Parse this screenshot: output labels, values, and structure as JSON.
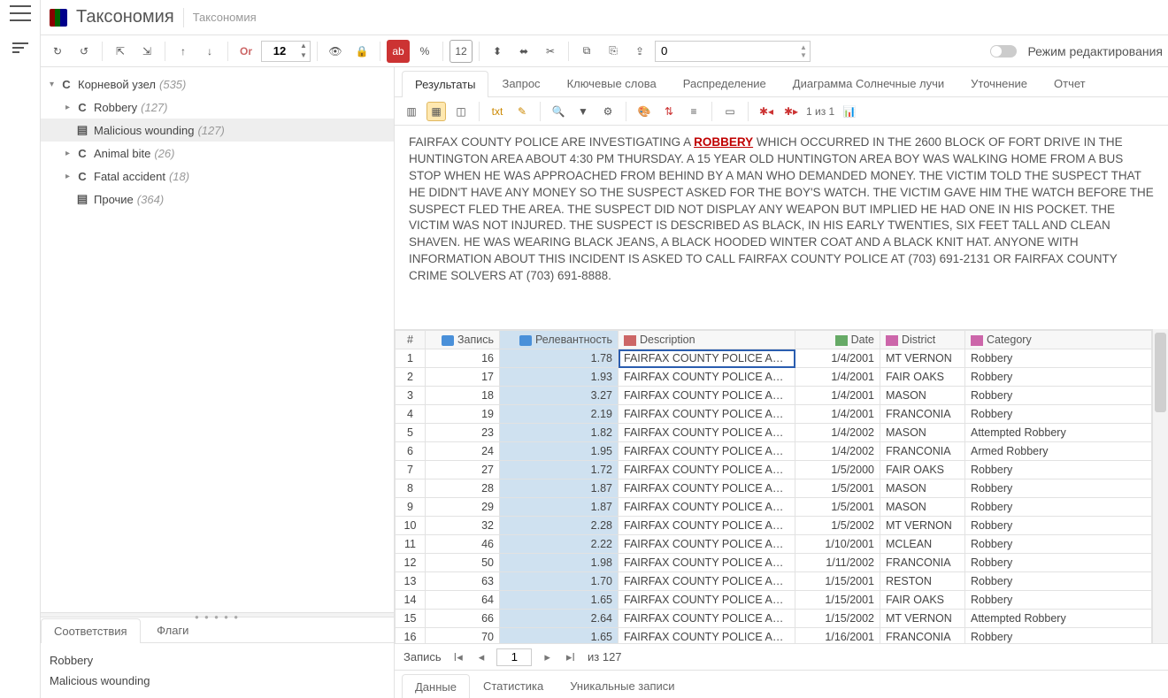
{
  "header": {
    "title": "Таксономия",
    "subtitle": "Таксономия"
  },
  "toolbar": {
    "font_size": "12",
    "offset": "0",
    "edit_mode_label": "Режим редактирования"
  },
  "tree": {
    "root": {
      "type": "C",
      "label": "Корневой узел",
      "count": "(535)"
    },
    "items": [
      {
        "type": "C",
        "label": "Robbery",
        "count": "(127)"
      },
      {
        "type": "▤",
        "label": "Malicious wounding",
        "count": "(127)",
        "selected": true
      },
      {
        "type": "C",
        "label": "Animal bite",
        "count": "(26)"
      },
      {
        "type": "C",
        "label": "Fatal accident",
        "count": "(18)"
      },
      {
        "type": "▤",
        "label": "Прочие",
        "count": "(364)"
      }
    ]
  },
  "left_bottom": {
    "tabs": {
      "match": "Соответствия",
      "flags": "Флаги"
    },
    "items": [
      "Robbery",
      "Malicious wounding"
    ]
  },
  "right_tabs": {
    "results": "Результаты",
    "query": "Запрос",
    "keywords": "Ключевые слова",
    "dist": "Распределение",
    "sunburst": "Диаграмма Солнечные лучи",
    "refine": "Уточнение",
    "report": "Отчет"
  },
  "right_toolbar": {
    "counter": "1 из 1"
  },
  "passage": {
    "pre": "FAIRFAX COUNTY POLICE ARE INVESTIGATING A ",
    "hl": "ROBBERY",
    "post": " WHICH OCCURRED IN THE 2600 BLOCK OF FORT DRIVE IN THE HUNTINGTON AREA ABOUT 4:30 PM THURSDAY. A 15 YEAR OLD HUNTINGTON AREA BOY WAS WALKING HOME FROM A BUS STOP WHEN HE WAS APPROACHED FROM BEHIND BY A MAN WHO DEMANDED MONEY. THE VICTIM TOLD THE SUSPECT THAT HE DIDN'T HAVE ANY MONEY SO THE SUSPECT ASKED FOR THE BOY'S WATCH. THE VICTIM GAVE HIM THE WATCH BEFORE THE SUSPECT FLED THE AREA. THE SUSPECT DID NOT DISPLAY ANY WEAPON BUT IMPLIED HE HAD ONE IN HIS POCKET. THE VICTIM WAS NOT INJURED. THE SUSPECT IS DESCRIBED AS BLACK, IN HIS EARLY TWENTIES, SIX FEET TALL AND CLEAN SHAVEN. HE WAS WEARING BLACK JEANS, A BLACK HOODED WINTER COAT AND A BLACK KNIT HAT. ANYONE WITH INFORMATION ABOUT THIS INCIDENT IS ASKED TO CALL FAIRFAX COUNTY POLICE AT (703) 691-2131 OR FAIRFAX COUNTY CRIME SOLVERS AT (703) 691-8888."
  },
  "grid": {
    "headers": {
      "idx": "#",
      "rec": "Запись",
      "rel": "Релевантность",
      "desc": "Description",
      "date": "Date",
      "dist": "District",
      "cat": "Category"
    },
    "rows": [
      {
        "i": "1",
        "rec": "16",
        "rel": "1.78",
        "desc": "FAIRFAX COUNTY POLICE ARE INVE",
        "date": "1/4/2001",
        "dist": "MT VERNON",
        "cat": "Robbery"
      },
      {
        "i": "2",
        "rec": "17",
        "rel": "1.93",
        "desc": "FAIRFAX COUNTY POLICE ARE INVE",
        "date": "1/4/2001",
        "dist": "FAIR OAKS",
        "cat": "Robbery"
      },
      {
        "i": "3",
        "rec": "18",
        "rel": "3.27",
        "desc": "FAIRFAX COUNTY POLICE ARE INVE",
        "date": "1/4/2001",
        "dist": "MASON",
        "cat": "Robbery"
      },
      {
        "i": "4",
        "rec": "19",
        "rel": "2.19",
        "desc": "FAIRFAX COUNTY POLICE ARE INVE",
        "date": "1/4/2001",
        "dist": "FRANCONIA",
        "cat": "Robbery"
      },
      {
        "i": "5",
        "rec": "23",
        "rel": "1.82",
        "desc": "FAIRFAX COUNTY POLICE ARE INVE",
        "date": "1/4/2002",
        "dist": "MASON",
        "cat": "Attempted Robbery"
      },
      {
        "i": "6",
        "rec": "24",
        "rel": "1.95",
        "desc": "FAIRFAX COUNTY POLICE ARE INVE",
        "date": "1/4/2002",
        "dist": "FRANCONIA",
        "cat": "Armed Robbery"
      },
      {
        "i": "7",
        "rec": "27",
        "rel": "1.72",
        "desc": "FAIRFAX COUNTY POLICE ARE INVE",
        "date": "1/5/2000",
        "dist": "FAIR OAKS",
        "cat": "Robbery"
      },
      {
        "i": "8",
        "rec": "28",
        "rel": "1.87",
        "desc": "FAIRFAX COUNTY POLICE ARE INVE",
        "date": "1/5/2001",
        "dist": "MASON",
        "cat": "Robbery"
      },
      {
        "i": "9",
        "rec": "29",
        "rel": "1.87",
        "desc": "FAIRFAX COUNTY POLICE ARE INVE",
        "date": "1/5/2001",
        "dist": "MASON",
        "cat": "Robbery"
      },
      {
        "i": "10",
        "rec": "32",
        "rel": "2.28",
        "desc": "FAIRFAX COUNTY POLICE ARE INVE",
        "date": "1/5/2002",
        "dist": "MT VERNON",
        "cat": "Robbery"
      },
      {
        "i": "11",
        "rec": "46",
        "rel": "2.22",
        "desc": "FAIRFAX COUNTY POLICE ARE INVE",
        "date": "1/10/2001",
        "dist": "MCLEAN",
        "cat": "Robbery"
      },
      {
        "i": "12",
        "rec": "50",
        "rel": "1.98",
        "desc": "FAIRFAX COUNTY POLICE ARE INVE",
        "date": "1/11/2002",
        "dist": "FRANCONIA",
        "cat": "Robbery"
      },
      {
        "i": "13",
        "rec": "63",
        "rel": "1.70",
        "desc": "FAIRFAX COUNTY POLICE ARE INVE",
        "date": "1/15/2001",
        "dist": "RESTON",
        "cat": "Robbery"
      },
      {
        "i": "14",
        "rec": "64",
        "rel": "1.65",
        "desc": "FAIRFAX COUNTY POLICE ARE INVE",
        "date": "1/15/2001",
        "dist": "FAIR OAKS",
        "cat": "Robbery"
      },
      {
        "i": "15",
        "rec": "66",
        "rel": "2.64",
        "desc": "FAIRFAX COUNTY POLICE ARRESTE",
        "date": "1/15/2002",
        "dist": "MT VERNON",
        "cat": "Attempted Robbery"
      },
      {
        "i": "16",
        "rec": "70",
        "rel": "1.65",
        "desc": "FAIRFAX COUNTY POLICE ARE INVE",
        "date": "1/16/2001",
        "dist": "FRANCONIA",
        "cat": "Robbery"
      }
    ]
  },
  "pager": {
    "label": "Запись",
    "page": "1",
    "of_label": "из 127"
  },
  "footer_tabs": {
    "data": "Данные",
    "stats": "Статистика",
    "unique": "Уникальные записи"
  }
}
